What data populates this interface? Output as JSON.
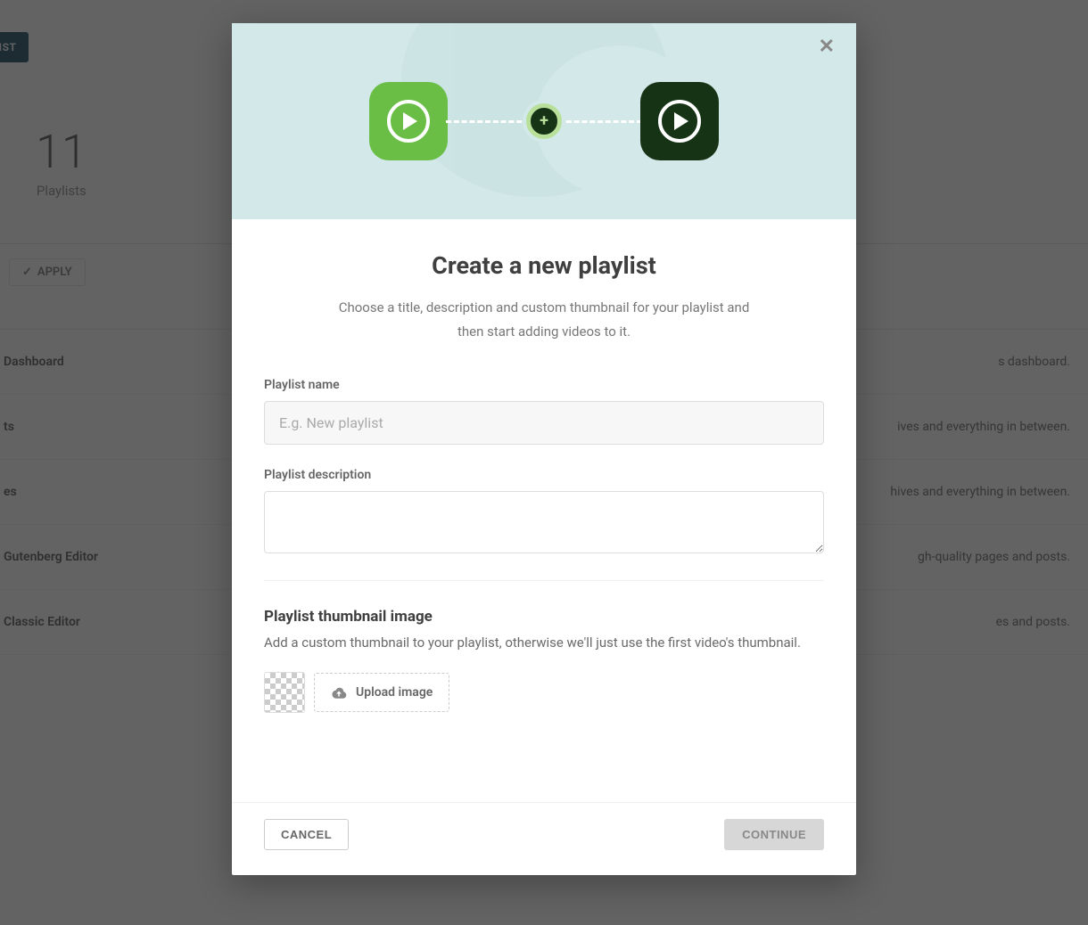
{
  "background": {
    "create_playlist_btn": "ATE PLAYLIST",
    "stat_number": "11",
    "stat_label": "Playlists",
    "apply_label": "APPLY",
    "rows": [
      {
        "left": "Dashboard",
        "right": "s dashboard."
      },
      {
        "left": "ts",
        "right": "ives and everything in between."
      },
      {
        "left": "es",
        "right": "hives and everything in between."
      },
      {
        "left": "Gutenberg Editor",
        "right": "gh-quality pages and posts."
      },
      {
        "left": "Classic Editor",
        "right": "es and posts."
      }
    ]
  },
  "modal": {
    "title": "Create a new playlist",
    "subtitle": "Choose a title, description and custom thumbnail for your playlist and then start adding videos to it.",
    "name_label": "Playlist name",
    "name_placeholder": "E.g. New playlist",
    "desc_label": "Playlist description",
    "thumb_heading": "Playlist thumbnail image",
    "thumb_desc": "Add a custom thumbnail to your playlist, otherwise we'll just use the first video's thumbnail.",
    "upload_label": "Upload image",
    "cancel_label": "CANCEL",
    "continue_label": "CONTINUE"
  }
}
